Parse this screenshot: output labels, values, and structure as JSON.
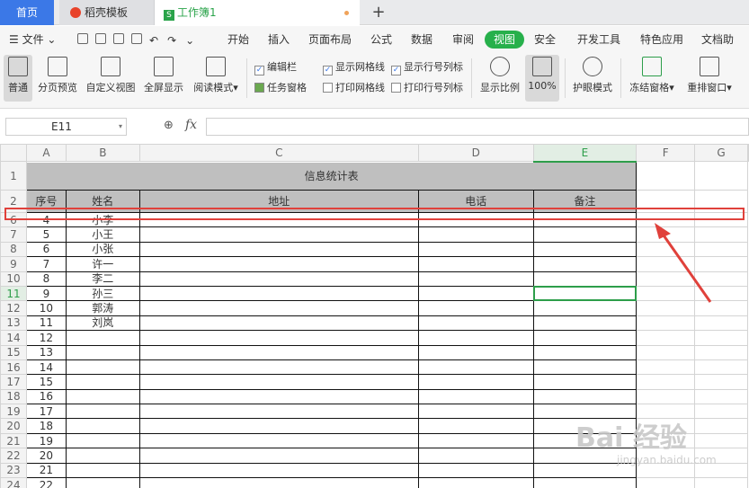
{
  "tabs": {
    "home": "首页",
    "templates": "稻壳模板",
    "workbook": "工作簿1",
    "workbook_icon": "S",
    "new_tab": "+"
  },
  "menu": {
    "file": "文件",
    "items": [
      "开始",
      "插入",
      "页面布局",
      "公式",
      "数据",
      "审阅",
      "视图",
      "安全",
      "开发工具",
      "特色应用",
      "文档助手"
    ],
    "active": "视图"
  },
  "ribbon": {
    "buttons": [
      "普通",
      "分页预览",
      "自定义视图",
      "全屏显示",
      "阅读模式",
      "显示比例",
      "100%",
      "护眼模式",
      "冻结窗格",
      "重排窗口"
    ],
    "checks": [
      {
        "label": "编辑栏",
        "checked": true
      },
      {
        "label": "显示网格线",
        "checked": true
      },
      {
        "label": "显示行号列标",
        "checked": true
      },
      {
        "label": "任务窗格",
        "checked": false
      },
      {
        "label": "打印网格线",
        "checked": false
      },
      {
        "label": "打印行号列标",
        "checked": false
      }
    ]
  },
  "formula_bar": {
    "cell_ref": "E11",
    "fx": "fx",
    "value": ""
  },
  "sheet": {
    "columns": [
      "A",
      "B",
      "C",
      "D",
      "E",
      "F",
      "G"
    ],
    "selected_column": "E",
    "selected_row": "11",
    "title": "信息统计表",
    "headers": [
      "序号",
      "姓名",
      "地址",
      "电话",
      "备注"
    ],
    "rows": [
      {
        "rownum": "6",
        "seq": "4",
        "name": "小李"
      },
      {
        "rownum": "7",
        "seq": "5",
        "name": "小王"
      },
      {
        "rownum": "8",
        "seq": "6",
        "name": "小张"
      },
      {
        "rownum": "9",
        "seq": "7",
        "name": "许一"
      },
      {
        "rownum": "10",
        "seq": "8",
        "name": "李二"
      },
      {
        "rownum": "11",
        "seq": "9",
        "name": "孙三"
      },
      {
        "rownum": "12",
        "seq": "10",
        "name": "郭涛"
      },
      {
        "rownum": "13",
        "seq": "11",
        "name": "刘岚"
      },
      {
        "rownum": "14",
        "seq": "12",
        "name": ""
      },
      {
        "rownum": "15",
        "seq": "13",
        "name": ""
      },
      {
        "rownum": "16",
        "seq": "14",
        "name": ""
      },
      {
        "rownum": "17",
        "seq": "15",
        "name": ""
      },
      {
        "rownum": "18",
        "seq": "16",
        "name": ""
      },
      {
        "rownum": "19",
        "seq": "17",
        "name": ""
      },
      {
        "rownum": "20",
        "seq": "18",
        "name": ""
      },
      {
        "rownum": "21",
        "seq": "19",
        "name": ""
      },
      {
        "rownum": "22",
        "seq": "20",
        "name": ""
      },
      {
        "rownum": "23",
        "seq": "21",
        "name": ""
      },
      {
        "rownum": "24",
        "seq": "22",
        "name": ""
      }
    ]
  },
  "annotation": {
    "highlight_color": "#e0413b"
  },
  "watermark": {
    "main": "Bai 经验",
    "sub": "jingyan.baidu.com"
  }
}
